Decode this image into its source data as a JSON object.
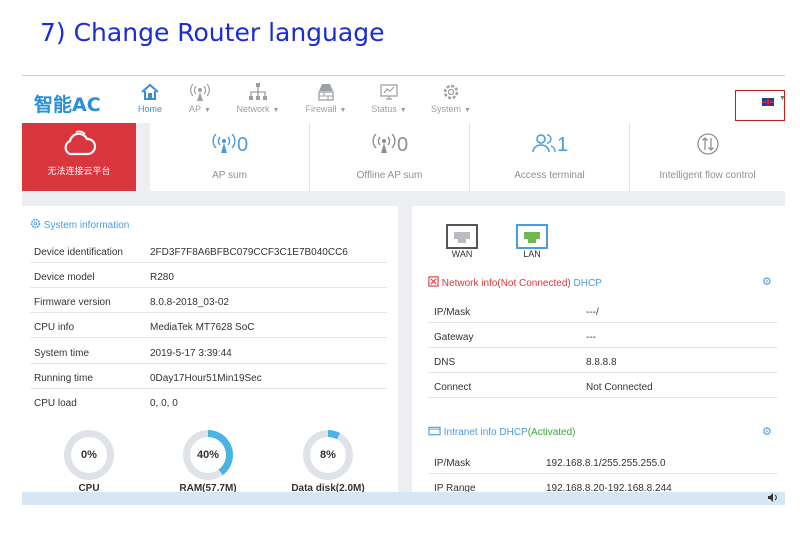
{
  "caption": "7) Change Router language",
  "header": {
    "logo": "智能AC",
    "nav": [
      {
        "label": "Home",
        "icon": "home-icon"
      },
      {
        "label": "AP",
        "icon": "antenna-icon"
      },
      {
        "label": "Network",
        "icon": "network-icon"
      },
      {
        "label": "Firewall",
        "icon": "firewall-icon"
      },
      {
        "label": "Status",
        "icon": "monitor-icon"
      },
      {
        "label": "System",
        "icon": "gear-icon"
      }
    ],
    "language_icon": "uk-flag-icon"
  },
  "cloud": {
    "label": "无法连接云平台",
    "icon": "cloud-icon"
  },
  "stats": [
    {
      "value": "0",
      "label": "AP sum",
      "icon": "antenna-icon"
    },
    {
      "value": "0",
      "label": "Offline AP sum",
      "icon": "antenna-icon"
    },
    {
      "value": "1",
      "label": "Access terminal",
      "icon": "users-icon"
    },
    {
      "value": "",
      "label": "Intelligent flow control",
      "icon": "flow-icon"
    }
  ],
  "system": {
    "title": "System information",
    "rows": [
      {
        "key": "Device identification",
        "value": "2FD3F7F8A6BFBC079CCF3C1E7B040CC6"
      },
      {
        "key": "Device model",
        "value": "R280"
      },
      {
        "key": "Firmware version",
        "value": "8.0.8-2018_03-02"
      },
      {
        "key": "CPU info",
        "value": "MediaTek MT7628 SoC"
      },
      {
        "key": "System time",
        "value": "2019-5-17 3:39:44"
      },
      {
        "key": "Running time",
        "value": "0Day17Hour51Min19Sec"
      },
      {
        "key": "CPU load",
        "value": "0, 0, 0"
      }
    ],
    "gauges": [
      {
        "label": "CPU",
        "value_text": "0%",
        "fraction": 0.0
      },
      {
        "label": "RAM(57.7M)",
        "value_text": "40%",
        "fraction": 0.4
      },
      {
        "label": "Data disk(2.0M)",
        "value_text": "8%",
        "fraction": 0.08
      }
    ]
  },
  "network": {
    "ports": [
      {
        "label": "WAN"
      },
      {
        "label": "LAN"
      }
    ],
    "net_title": "Network info(Not Connected)",
    "net_mode": "DHCP",
    "net_rows": [
      {
        "key": "IP/Mask",
        "value": "---/"
      },
      {
        "key": "Gateway",
        "value": "---"
      },
      {
        "key": "DNS",
        "value": "8.8.8.8"
      },
      {
        "key": "Connect",
        "value": "Not Connected"
      }
    ],
    "intranet_title": "Intranet info DHCP",
    "intranet_status": "(Activated)",
    "intranet_rows": [
      {
        "key": "IP/Mask",
        "value": "192.168.8.1/255.255.255.0"
      },
      {
        "key": "IP Range",
        "value": "192.168.8.20-192.168.8.244"
      }
    ]
  },
  "colors": {
    "accent": "#4a9be0",
    "alert": "#d9363e",
    "activated": "#3aa63a"
  }
}
